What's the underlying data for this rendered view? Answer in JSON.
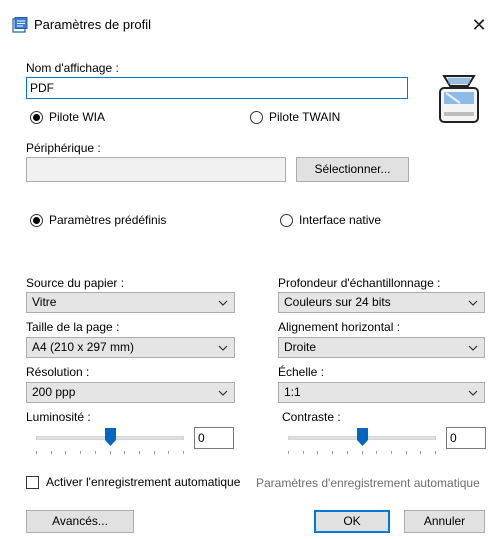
{
  "window": {
    "title": "Paramètres de profil"
  },
  "form": {
    "display_name_label": "Nom d'affichage :",
    "display_name_value": "PDF",
    "driver_wia_label": "Pilote WIA",
    "driver_twain_label": "Pilote TWAIN",
    "device_label": "Périphérique :",
    "device_value": "",
    "select_device_button": "Sélectionner...",
    "predefined_params_label": "Paramètres prédéfinis",
    "native_interface_label": "Interface native",
    "paper_source_label": "Source du papier :",
    "paper_source_value": "Vitre",
    "bit_depth_label": "Profondeur d'échantillonnage :",
    "bit_depth_value": "Couleurs sur 24 bits",
    "page_size_label": "Taille de la page :",
    "page_size_value": "A4 (210 x 297 mm)",
    "h_align_label": "Alignement horizontal :",
    "h_align_value": "Droite",
    "resolution_label": "Résolution :",
    "resolution_value": "200 ppp",
    "scale_label": "Échelle :",
    "scale_value": "1:1",
    "brightness_label": "Luminosité :",
    "brightness_value": "0",
    "contrast_label": "Contraste :",
    "contrast_value": "0",
    "autosave_label": "Activer l'enregistrement automatique",
    "autosave_settings_link": "Paramètres d'enregistrement automatique",
    "advanced_button": "Avancés...",
    "ok_button": "OK",
    "cancel_button": "Annuler"
  },
  "state": {
    "driver": "WIA",
    "mode": "predefined",
    "autosave_checked": false,
    "brightness_level_fraction": 0.5,
    "contrast_level_fraction": 0.5
  },
  "colors": {
    "accent": "#0078d7",
    "slider_thumb": "#0067c0"
  },
  "icons": {
    "app": "scanner-app-icon",
    "device": "scanner-device-icon",
    "close": "close-icon"
  }
}
